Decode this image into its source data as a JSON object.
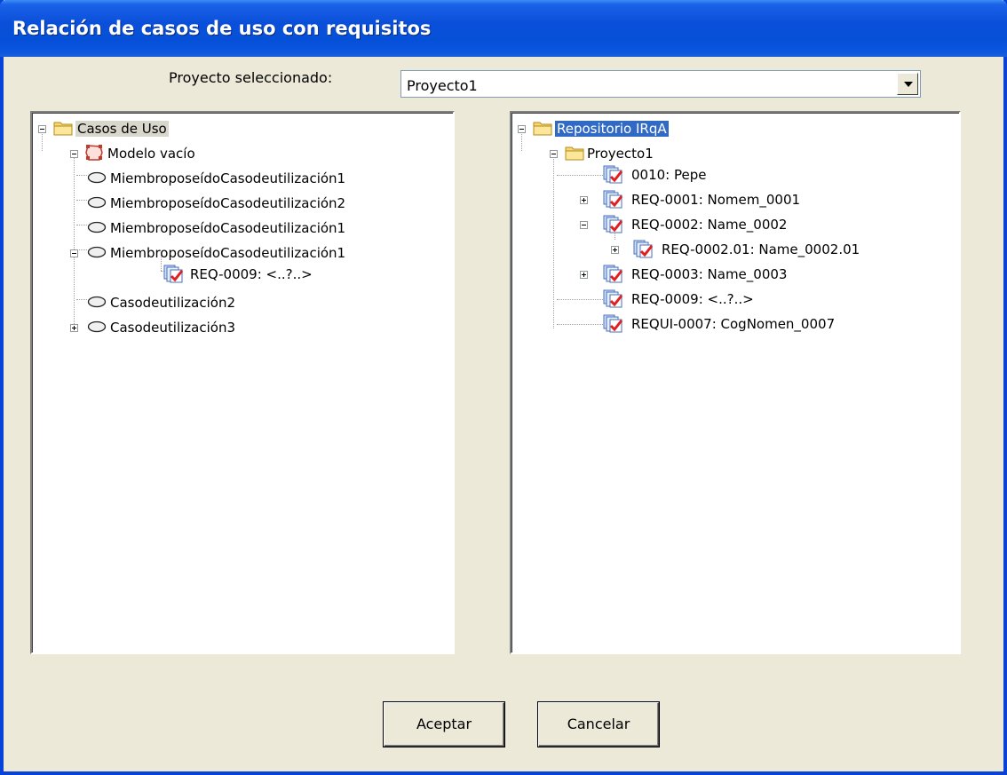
{
  "window": {
    "title": "Relación de casos de uso con requisitos"
  },
  "project": {
    "label": "Proyecto seleccionado:",
    "selected": "Proyecto1"
  },
  "left_tree": {
    "root": "Casos de Uso",
    "model": "Modelo vacío",
    "items": [
      "MiembroposeídoCasodeutilización1",
      "MiembroposeídoCasodeutilización2",
      "MiembroposeídoCasodeutilización1",
      "MiembroposeídoCasodeutilización1",
      "REQ-0009: <..?..>",
      "Casodeutilización2",
      "Casodeutilización3"
    ]
  },
  "right_tree": {
    "root": "Repositorio IRqA",
    "project": "Proyecto1",
    "items": [
      "0010: Pepe",
      "REQ-0001: Nomem_0001",
      "REQ-0002: Name_0002",
      "REQ-0002.01: Name_0002.01",
      "REQ-0003: Name_0003",
      "REQ-0009: <..?..>",
      "REQUI-0007: CogNomen_0007"
    ]
  },
  "buttons": {
    "accept": "Aceptar",
    "cancel": "Cancelar"
  }
}
